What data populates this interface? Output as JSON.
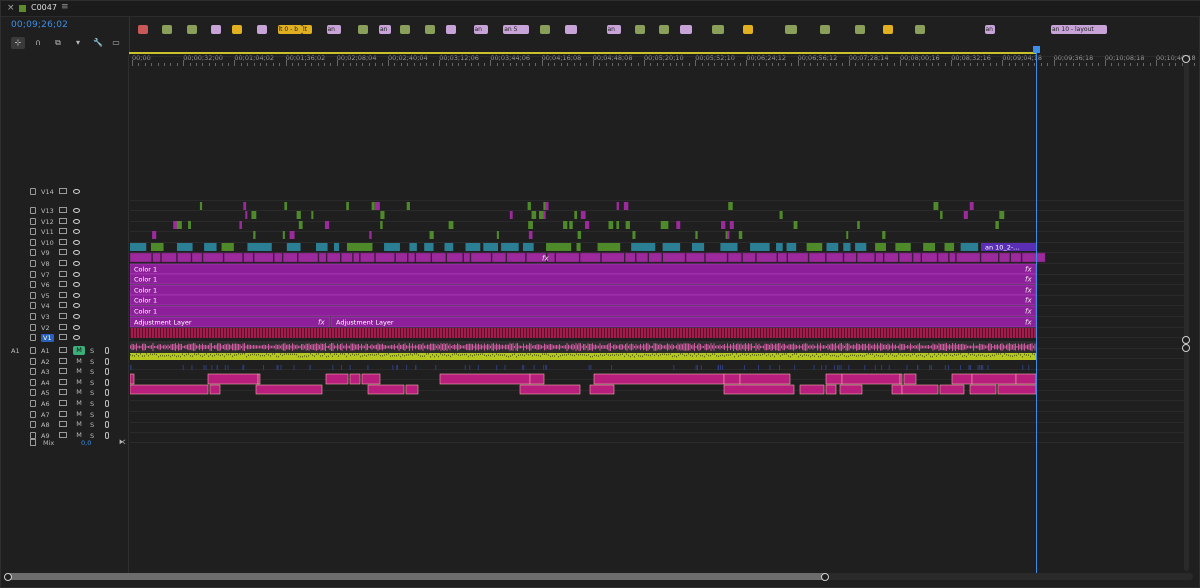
{
  "tab": {
    "close": "×",
    "title": "C0047",
    "menu": "≡",
    "swatch_color": "#5f8a2b"
  },
  "timecode": "00;09;26;02",
  "tools": [
    {
      "name": "snap-icon",
      "glyph": "⊹",
      "active": true
    },
    {
      "name": "magnet-icon",
      "glyph": "∩",
      "active": false
    },
    {
      "name": "linked-selection-icon",
      "glyph": "⧉",
      "active": false
    },
    {
      "name": "add-marker-icon",
      "glyph": "▾",
      "active": false
    },
    {
      "name": "wrench-icon",
      "glyph": "🔧",
      "active": false
    },
    {
      "name": "captions-icon",
      "glyph": "▭",
      "active": false
    }
  ],
  "ruler_labels": [
    "00;00",
    "00;00;32;00",
    "00;01;04;02",
    "00;01;36;02",
    "00;02;08;04",
    "00;02;40;04",
    "00;03;12;06",
    "00;03;44;06",
    "00;04;16;08",
    "00;04;48;08",
    "00;05;20;10",
    "00;05;52;10",
    "00;06;24;12",
    "00;06;56;12",
    "00;07;28;14",
    "00;08;00;16",
    "00;08;32;16",
    "00;09;04;18",
    "00;09;36;18",
    "00;10;08;18",
    "00;10;40;18"
  ],
  "markers": [
    {
      "label": "",
      "color": "#c95858"
    },
    {
      "label": "",
      "color": "#8aa05a"
    },
    {
      "label": "",
      "color": "#8aa05a"
    },
    {
      "label": "",
      "color": "#c7a3d8"
    },
    {
      "label": "",
      "color": "#e0b020"
    },
    {
      "label": "",
      "color": "#c7a3d8"
    },
    {
      "label": "lt 0 - b",
      "color": "#e0b020"
    },
    {
      "label": "lt",
      "color": "#e0b020"
    },
    {
      "label": "an",
      "color": "#c7a3d8"
    },
    {
      "label": "",
      "color": "#8aa05a"
    },
    {
      "label": "an",
      "color": "#c7a3d8"
    },
    {
      "label": "",
      "color": "#8aa05a"
    },
    {
      "label": "",
      "color": "#8aa05a"
    },
    {
      "label": "",
      "color": "#c7a3d8"
    },
    {
      "label": "an",
      "color": "#c7a3d8"
    },
    {
      "label": "an 5",
      "color": "#c7a3d8"
    },
    {
      "label": "",
      "color": "#8aa05a"
    },
    {
      "label": "",
      "color": "#c7a3d8"
    },
    {
      "label": "an",
      "color": "#c7a3d8"
    },
    {
      "label": "",
      "color": "#8aa05a"
    },
    {
      "label": "",
      "color": "#8aa05a"
    },
    {
      "label": "",
      "color": "#c7a3d8"
    },
    {
      "label": "",
      "color": "#8aa05a"
    },
    {
      "label": "",
      "color": "#e0b020"
    },
    {
      "label": "",
      "color": "#8aa05a"
    },
    {
      "label": "",
      "color": "#8aa05a"
    },
    {
      "label": "",
      "color": "#8aa05a"
    },
    {
      "label": "",
      "color": "#e0b020"
    },
    {
      "label": "",
      "color": "#8aa05a"
    },
    {
      "label": "an",
      "color": "#c7a3d8"
    },
    {
      "label": "an 10 - layout",
      "color": "#c7a3d8"
    }
  ],
  "video_tracks": [
    "V14",
    "V13",
    "V12",
    "V11",
    "V10",
    "V9",
    "V8",
    "V7",
    "V6",
    "V5",
    "V4",
    "V3",
    "V2",
    "V1"
  ],
  "audio_tracks": [
    "A1",
    "A2",
    "A3",
    "A4",
    "A5",
    "A6",
    "A7",
    "A8",
    "A9"
  ],
  "audio_source": "A1",
  "m_label": "M",
  "s_label": "S",
  "mix": {
    "label": "Mix",
    "value": "0,0"
  },
  "clips": {
    "color_label": "Color 1",
    "adjustment_label": "Adjustment Layer",
    "v9_end_label": "an 10_2-...",
    "fx": "fx"
  },
  "colors": {
    "accent": "#3d8ee8",
    "magenta": "#9c2a9c",
    "teal": "#2b7f95",
    "green": "#4f8a2a",
    "pink": "#d25aa2",
    "yellow_green": "#b7c820"
  }
}
